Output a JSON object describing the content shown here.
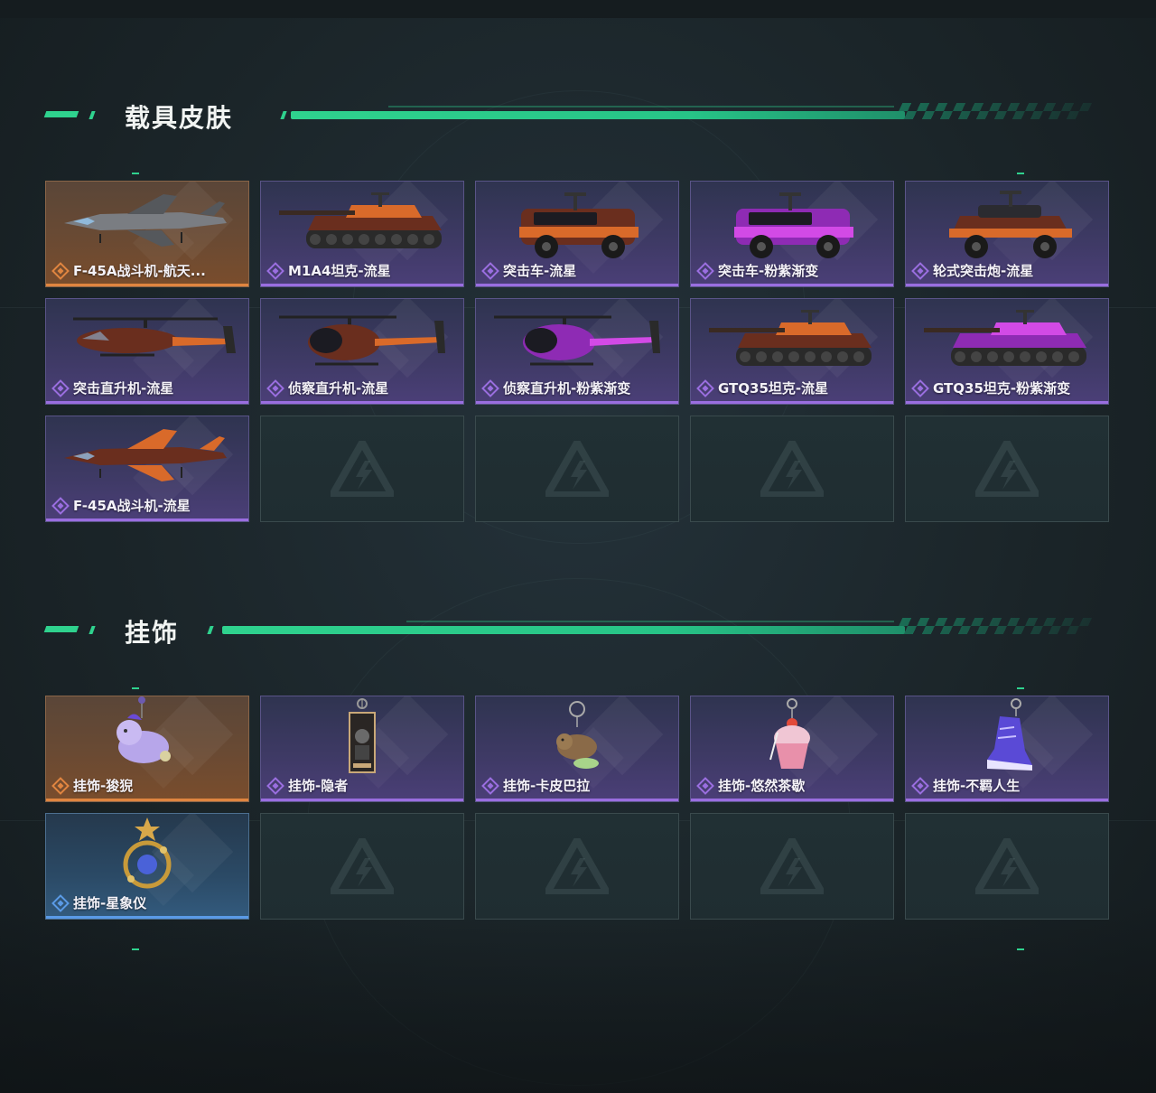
{
  "sections": {
    "vehicle_skins": {
      "title": "载具皮肤",
      "items": [
        {
          "name": "F-45A战斗机-航天...",
          "rarity": "orange",
          "icon": "jet-fighter-icon"
        },
        {
          "name": "M1A4坦克-流星",
          "rarity": "purple",
          "icon": "tank-icon"
        },
        {
          "name": "突击车-流星",
          "rarity": "purple",
          "icon": "assault-vehicle-icon"
        },
        {
          "name": "突击车-粉紫渐变",
          "rarity": "purple",
          "icon": "assault-vehicle-icon"
        },
        {
          "name": "轮式突击炮-流星",
          "rarity": "purple",
          "icon": "wheeled-assault-gun-icon"
        },
        {
          "name": "突击直升机-流星",
          "rarity": "purple",
          "icon": "attack-helicopter-icon"
        },
        {
          "name": "侦察直升机-流星",
          "rarity": "purple",
          "icon": "scout-helicopter-icon"
        },
        {
          "name": "侦察直升机-粉紫渐变",
          "rarity": "purple",
          "icon": "scout-helicopter-icon"
        },
        {
          "name": "GTQ35坦克-流星",
          "rarity": "purple",
          "icon": "tank-icon"
        },
        {
          "name": "GTQ35坦克-粉紫渐变",
          "rarity": "purple",
          "icon": "tank-icon"
        },
        {
          "name": "F-45A战斗机-流星",
          "rarity": "purple",
          "icon": "jet-fighter-icon"
        }
      ]
    },
    "charms": {
      "title": "挂饰",
      "items": [
        {
          "name": "挂饰-狻猊",
          "rarity": "orange",
          "icon": "lion-charm-icon"
        },
        {
          "name": "挂饰-隐者",
          "rarity": "purple",
          "icon": "tarot-card-charm-icon"
        },
        {
          "name": "挂饰-卡皮巴拉",
          "rarity": "purple",
          "icon": "capybara-charm-icon"
        },
        {
          "name": "挂饰-悠然茶歇",
          "rarity": "purple",
          "icon": "cupcake-charm-icon"
        },
        {
          "name": "挂饰-不羁人生",
          "rarity": "purple",
          "icon": "sneaker-charm-icon"
        },
        {
          "name": "挂饰-星象仪",
          "rarity": "blue",
          "icon": "astrolabe-charm-icon"
        }
      ]
    }
  },
  "colors": {
    "accent": "#2fd28e",
    "orange": "#e08540",
    "purple": "#9a6ee0",
    "blue": "#5a9ae6"
  }
}
